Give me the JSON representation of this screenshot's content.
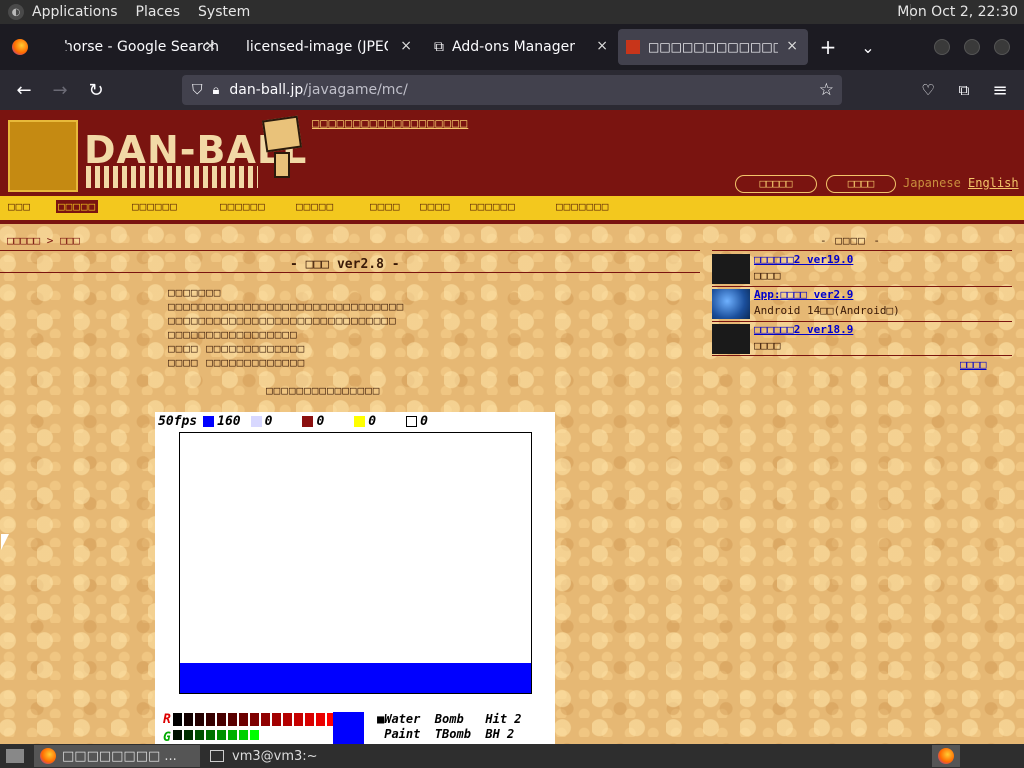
{
  "topbar": {
    "applications": "Applications",
    "places": "Places",
    "system": "System",
    "clock": "Mon Oct  2, 22:30"
  },
  "tabs": [
    {
      "label": "horse - Google Search",
      "close": "×"
    },
    {
      "label": "licensed-image (JPEG Ima",
      "close": "×"
    },
    {
      "label": "Add-ons Manager",
      "close": "×"
    },
    {
      "label": "□□□□□□□□□□□□□□□□□□",
      "close": "×"
    }
  ],
  "toolbar": {
    "new_tab": "+",
    "tab_list": "⌄"
  },
  "nav": {
    "back": "←",
    "forward": "→",
    "reload": "↻",
    "url_host": "dan-ball.jp",
    "url_path": "/javagame/mc/",
    "star": "☆"
  },
  "site": {
    "logo": "DAN-BALL",
    "top_link": "□□□□□□□□□□□□□□□□□□□",
    "login_label": "□□□□□",
    "register_label": "□□□□",
    "japanese": "Japanese",
    "english": "English",
    "nav_items": [
      "□□□",
      "□□□□□",
      "□□□□□□",
      "□□□□□□",
      "□□□□□",
      "□□□□",
      "□□□□",
      "□□□□□□",
      "□□□□□□□"
    ],
    "breadcrumb": "□□□□□ > □□□",
    "title": "- □□□ ver2.8 -",
    "desc": [
      "□□□□□□□",
      "□□□□□□□□□□□□□□□□□□□□□□□□□□□□□□□",
      "□□□□□□□□□□□□□□□□□□□□□□□□□□□□□□",
      "□□□□□□□□□□□□□□□□□",
      "□□□□  □□□□□□□□□□□□□",
      "□□□□  □□□□□□□□□□□□□"
    ],
    "center_link": "□□□□□□□□□□□□□□□",
    "side_title": "- □□□□ -",
    "side_items": [
      {
        "title": "□□□□□□2 ver19.0",
        "sub": "□□□□"
      },
      {
        "title": "App:□□□□ ver2.9",
        "sub": "Android 14□□(Android□)"
      },
      {
        "title": "□□□□□□2 ver18.9",
        "sub": "□□□□"
      }
    ],
    "more": "□□□□"
  },
  "game": {
    "fps": "50fps",
    "water_count": "160",
    "c2": "0",
    "c3": "0",
    "c4": "0",
    "c5": "0",
    "r_label": "R",
    "g_label": "G",
    "tools_row1": "■Water  Bomb   Hit 2",
    "tools_row2": " Paint  TBomb  BH 2"
  },
  "taskbar": {
    "terminal": "vm3@vm3:~",
    "firefox_title": "□□□□□□□□ ..."
  }
}
